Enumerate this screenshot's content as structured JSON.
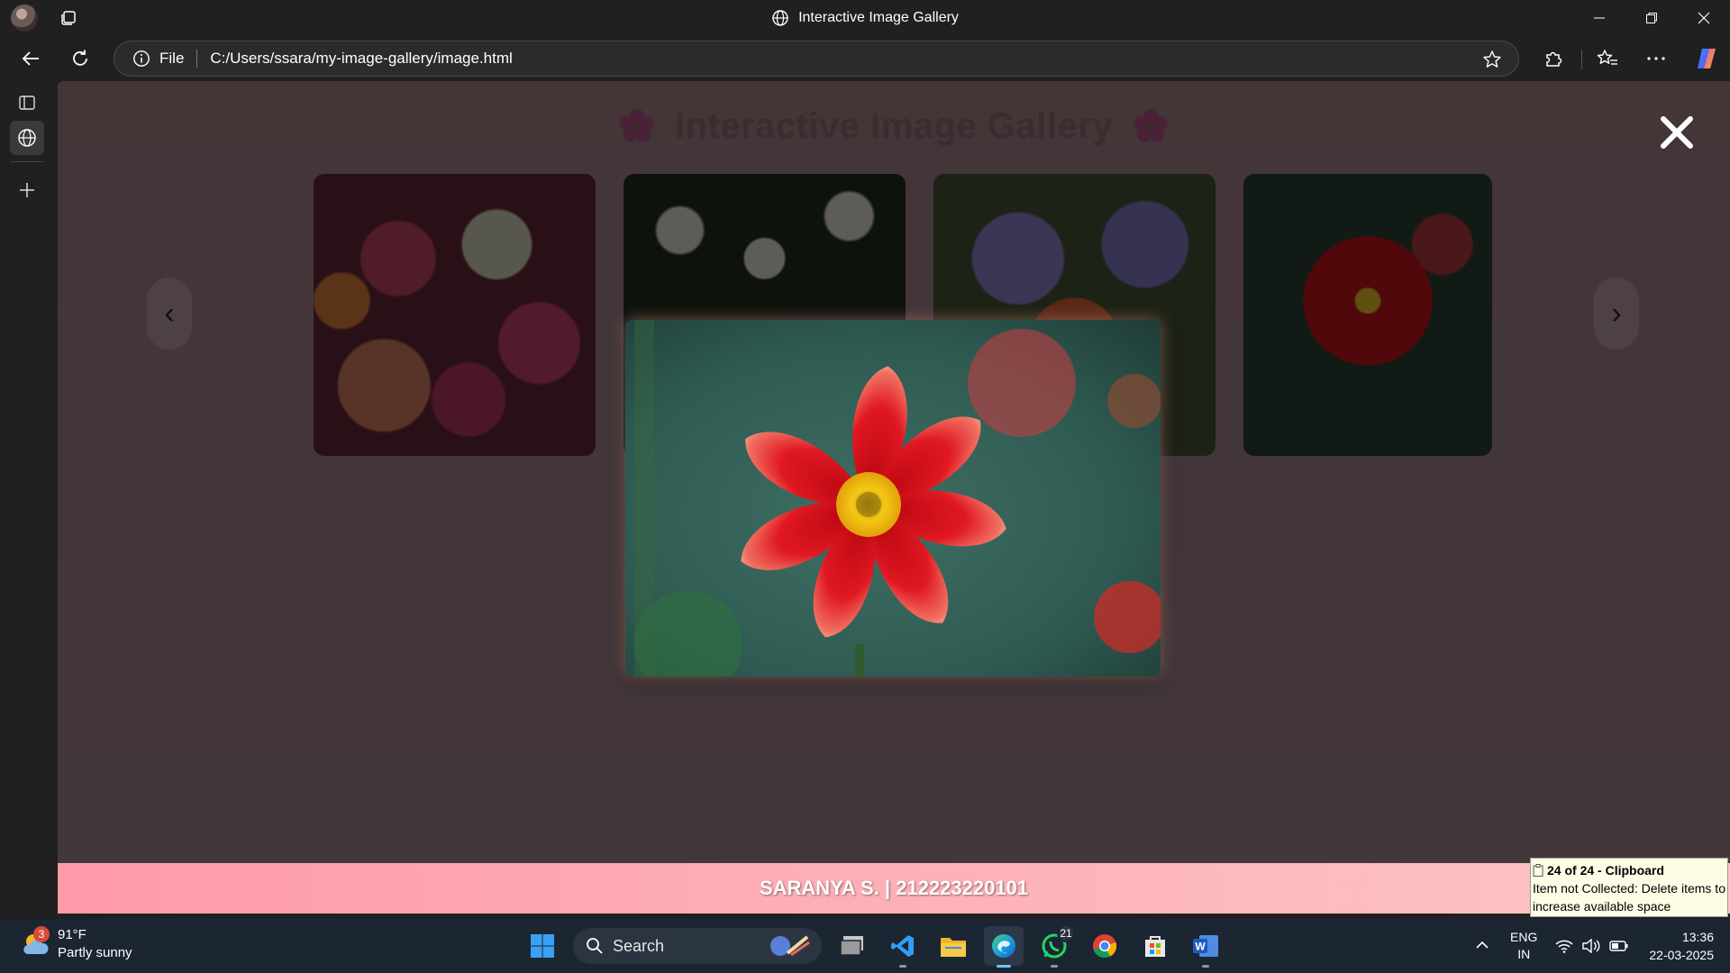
{
  "window": {
    "title": "Interactive Image Gallery"
  },
  "addressbar": {
    "scheme_label": "File",
    "url": "C:/Users/ssara/my-image-gallery/image.html"
  },
  "page": {
    "heading": "Interactive Image Gallery",
    "prev_arrow": "‹",
    "next_arrow": "›",
    "thumbnails": [
      {
        "subject": "roses"
      },
      {
        "subject": "daisies"
      },
      {
        "subject": "mixed flowers"
      },
      {
        "subject": "red dahlia"
      }
    ],
    "lightbox": {
      "subject": "red dahlia"
    },
    "footer_text": "SARANYA S. | 212223220101"
  },
  "toast": {
    "title": "24 of 24 - Clipboard",
    "body": "Item not Collected: Delete items to increase available space"
  },
  "taskbar": {
    "weather_temp": "91°F",
    "weather_desc": "Partly sunny",
    "weather_badge": "3",
    "search_placeholder": "Search",
    "whatsapp_badge": "21",
    "lang_top": "ENG",
    "lang_bottom": "IN",
    "time": "13:36",
    "date": "22-03-2025"
  },
  "colors": {
    "footer_gradient_start": "#ff9aa8",
    "footer_gradient_end": "#fcc6c6",
    "overlay": "#261c1d",
    "browser_chrome": "#202020",
    "taskbar": "#1c2532"
  }
}
